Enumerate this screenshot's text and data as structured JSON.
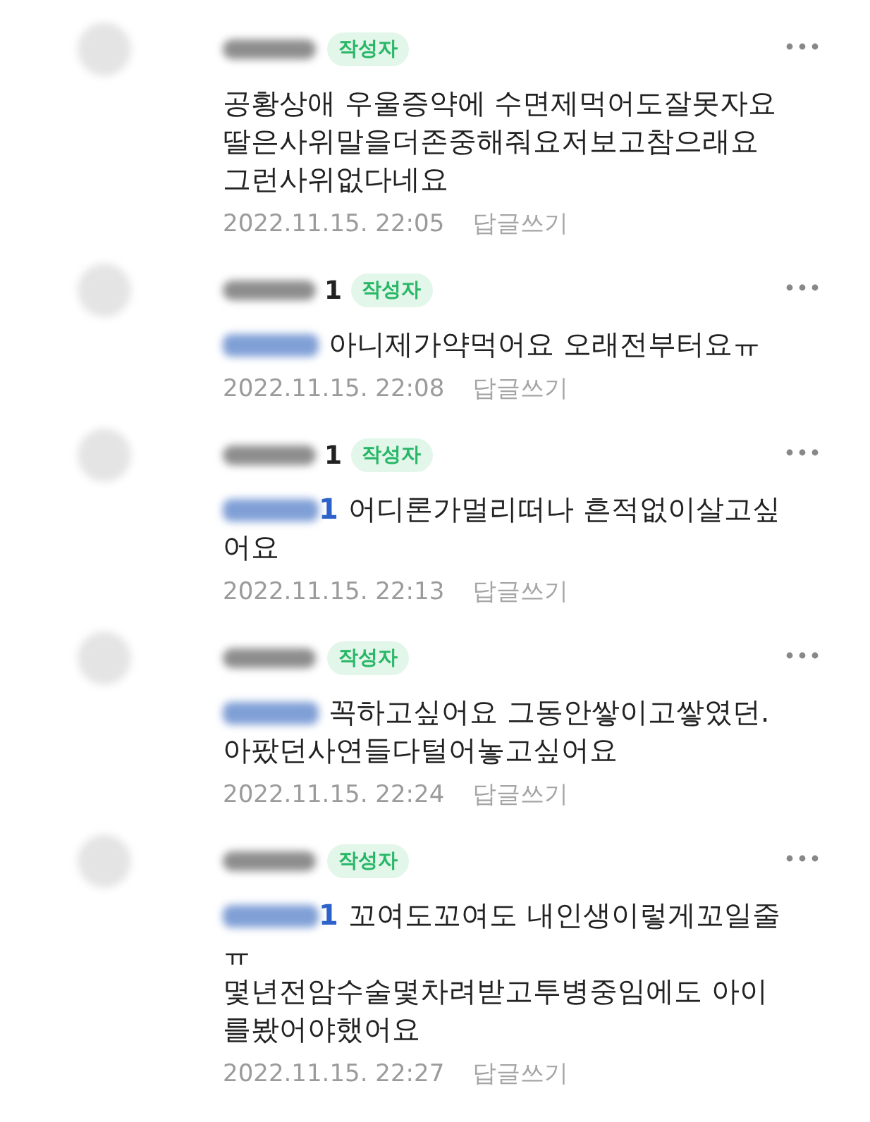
{
  "comments": [
    {
      "badge": "작성자",
      "reply_mention": false,
      "lines": [
        "공황상애 우울증약에 수면제먹어도잘못자요",
        "딸은사위말을더존중해줘요저보고참으래요",
        "그런사위없다네요"
      ],
      "date": "2022.11.15. 22:05",
      "reply_label": "답글쓰기"
    },
    {
      "author_suffix": "1",
      "badge": "작성자",
      "reply_mention": true,
      "lines": [
        "아니제가약먹어요 오래전부터요ㅠ"
      ],
      "date": "2022.11.15. 22:08",
      "reply_label": "답글쓰기"
    },
    {
      "author_suffix": "1",
      "badge": "작성자",
      "reply_mention": true,
      "mention_suffix": "1",
      "lines": [
        "어디론가멀리떠나 흔적없이살고싶",
        "어요"
      ],
      "date": "2022.11.15. 22:13",
      "reply_label": "답글쓰기"
    },
    {
      "badge": "작성자",
      "reply_mention": true,
      "lines": [
        "꼭하고싶어요 그동안쌓이고쌓였던.",
        "아팠던사연들다털어놓고싶어요"
      ],
      "date": "2022.11.15. 22:24",
      "reply_label": "답글쓰기"
    },
    {
      "badge": "작성자",
      "reply_mention": true,
      "mention_suffix": "1",
      "lines": [
        "꼬여도꼬여도 내인생이렇게꼬일줄",
        "ㅠ",
        "몇년전암수술몇차려받고투병중임에도 아이",
        "를봤어야했어요"
      ],
      "date": "2022.11.15. 22:27",
      "reply_label": "답글쓰기"
    }
  ]
}
